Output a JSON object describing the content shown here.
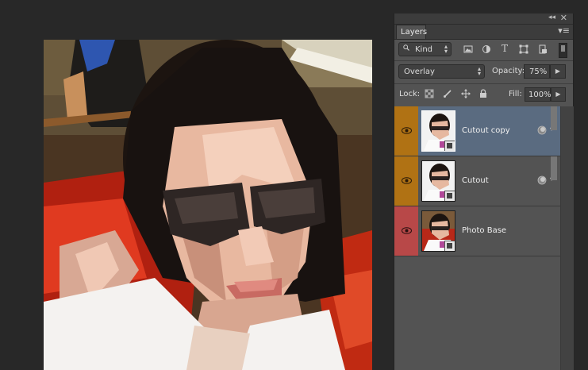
{
  "panel": {
    "tab_label": "Layers",
    "collapse_glyph": "◂◂",
    "close_glyph": "✕",
    "menu_glyph": "▾≡"
  },
  "filter": {
    "kind_label": "Kind",
    "icons": [
      "pixel-filter-icon",
      "adjustment-filter-icon",
      "type-filter-icon",
      "shape-filter-icon",
      "smart-object-filter-icon"
    ],
    "type_glyph": "T"
  },
  "blend": {
    "mode": "Overlay",
    "opacity_label": "Opacity:",
    "opacity_value": "75%"
  },
  "lock": {
    "lock_label": "Lock:",
    "fill_label": "Fill:",
    "fill_value": "100%"
  },
  "layers": [
    {
      "name": "Cutout copy",
      "selected": true,
      "color": "#b07214",
      "has_fx": true
    },
    {
      "name": "Cutout",
      "selected": false,
      "color": "#b07214",
      "has_fx": true
    },
    {
      "name": "Photo Base",
      "selected": false,
      "color": "#b84848",
      "has_fx": false
    }
  ],
  "colors": {
    "orange_label": "#b07214",
    "red_label": "#b84848",
    "selected_row": "#5a6b80"
  }
}
